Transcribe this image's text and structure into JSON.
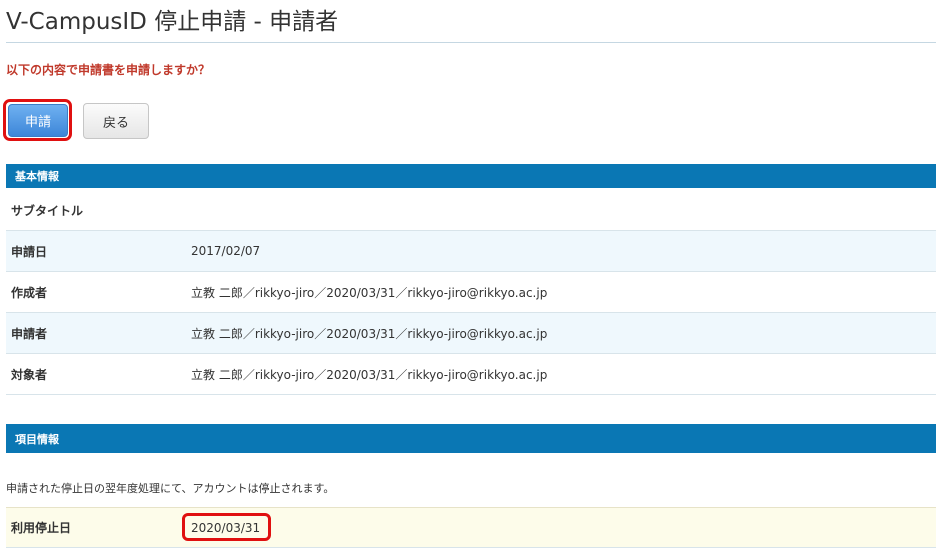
{
  "page": {
    "title": "V-CampusID 停止申請 - 申請者",
    "confirm_message": "以下の内容で申請書を申請しますか？"
  },
  "buttons": {
    "apply_label": "申請",
    "back_label": "戻る"
  },
  "basic_info": {
    "heading": "基本情報",
    "rows": [
      {
        "label": "サブタイトル",
        "value": ""
      },
      {
        "label": "申請日",
        "value": "2017/02/07"
      },
      {
        "label": "作成者",
        "value": "立教 二郎／rikkyo-jiro／2020/03/31／rikkyo-jiro@rikkyo.ac.jp"
      },
      {
        "label": "申請者",
        "value": "立教 二郎／rikkyo-jiro／2020/03/31／rikkyo-jiro@rikkyo.ac.jp"
      },
      {
        "label": "対象者",
        "value": "立教 二郎／rikkyo-jiro／2020/03/31／rikkyo-jiro@rikkyo.ac.jp"
      }
    ]
  },
  "item_info": {
    "heading": "項目情報",
    "note": "申請された停止日の翌年度処理にて、アカウントは停止されます。",
    "rows": [
      {
        "label": "利用停止日",
        "value": "2020/03/31"
      }
    ]
  },
  "colors": {
    "section_header": "#0a77b4",
    "confirm_text": "#c0392b",
    "highlight": "#e01010",
    "primary_button": "#3d86d8"
  }
}
